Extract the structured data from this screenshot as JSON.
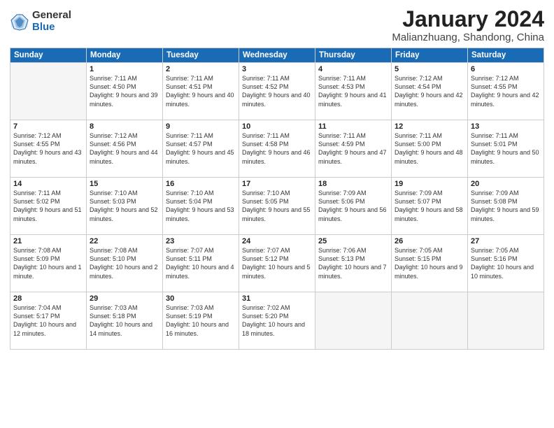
{
  "logo": {
    "general": "General",
    "blue": "Blue"
  },
  "title": "January 2024",
  "subtitle": "Malianzhuang, Shandong, China",
  "headers": [
    "Sunday",
    "Monday",
    "Tuesday",
    "Wednesday",
    "Thursday",
    "Friday",
    "Saturday"
  ],
  "weeks": [
    [
      {
        "day": "",
        "empty": true
      },
      {
        "day": "1",
        "sunrise": "Sunrise: 7:11 AM",
        "sunset": "Sunset: 4:50 PM",
        "daylight": "Daylight: 9 hours and 39 minutes."
      },
      {
        "day": "2",
        "sunrise": "Sunrise: 7:11 AM",
        "sunset": "Sunset: 4:51 PM",
        "daylight": "Daylight: 9 hours and 40 minutes."
      },
      {
        "day": "3",
        "sunrise": "Sunrise: 7:11 AM",
        "sunset": "Sunset: 4:52 PM",
        "daylight": "Daylight: 9 hours and 40 minutes."
      },
      {
        "day": "4",
        "sunrise": "Sunrise: 7:11 AM",
        "sunset": "Sunset: 4:53 PM",
        "daylight": "Daylight: 9 hours and 41 minutes."
      },
      {
        "day": "5",
        "sunrise": "Sunrise: 7:12 AM",
        "sunset": "Sunset: 4:54 PM",
        "daylight": "Daylight: 9 hours and 42 minutes."
      },
      {
        "day": "6",
        "sunrise": "Sunrise: 7:12 AM",
        "sunset": "Sunset: 4:55 PM",
        "daylight": "Daylight: 9 hours and 42 minutes."
      }
    ],
    [
      {
        "day": "7",
        "sunrise": "Sunrise: 7:12 AM",
        "sunset": "Sunset: 4:55 PM",
        "daylight": "Daylight: 9 hours and 43 minutes."
      },
      {
        "day": "8",
        "sunrise": "Sunrise: 7:12 AM",
        "sunset": "Sunset: 4:56 PM",
        "daylight": "Daylight: 9 hours and 44 minutes."
      },
      {
        "day": "9",
        "sunrise": "Sunrise: 7:11 AM",
        "sunset": "Sunset: 4:57 PM",
        "daylight": "Daylight: 9 hours and 45 minutes."
      },
      {
        "day": "10",
        "sunrise": "Sunrise: 7:11 AM",
        "sunset": "Sunset: 4:58 PM",
        "daylight": "Daylight: 9 hours and 46 minutes."
      },
      {
        "day": "11",
        "sunrise": "Sunrise: 7:11 AM",
        "sunset": "Sunset: 4:59 PM",
        "daylight": "Daylight: 9 hours and 47 minutes."
      },
      {
        "day": "12",
        "sunrise": "Sunrise: 7:11 AM",
        "sunset": "Sunset: 5:00 PM",
        "daylight": "Daylight: 9 hours and 48 minutes."
      },
      {
        "day": "13",
        "sunrise": "Sunrise: 7:11 AM",
        "sunset": "Sunset: 5:01 PM",
        "daylight": "Daylight: 9 hours and 50 minutes."
      }
    ],
    [
      {
        "day": "14",
        "sunrise": "Sunrise: 7:11 AM",
        "sunset": "Sunset: 5:02 PM",
        "daylight": "Daylight: 9 hours and 51 minutes."
      },
      {
        "day": "15",
        "sunrise": "Sunrise: 7:10 AM",
        "sunset": "Sunset: 5:03 PM",
        "daylight": "Daylight: 9 hours and 52 minutes."
      },
      {
        "day": "16",
        "sunrise": "Sunrise: 7:10 AM",
        "sunset": "Sunset: 5:04 PM",
        "daylight": "Daylight: 9 hours and 53 minutes."
      },
      {
        "day": "17",
        "sunrise": "Sunrise: 7:10 AM",
        "sunset": "Sunset: 5:05 PM",
        "daylight": "Daylight: 9 hours and 55 minutes."
      },
      {
        "day": "18",
        "sunrise": "Sunrise: 7:09 AM",
        "sunset": "Sunset: 5:06 PM",
        "daylight": "Daylight: 9 hours and 56 minutes."
      },
      {
        "day": "19",
        "sunrise": "Sunrise: 7:09 AM",
        "sunset": "Sunset: 5:07 PM",
        "daylight": "Daylight: 9 hours and 58 minutes."
      },
      {
        "day": "20",
        "sunrise": "Sunrise: 7:09 AM",
        "sunset": "Sunset: 5:08 PM",
        "daylight": "Daylight: 9 hours and 59 minutes."
      }
    ],
    [
      {
        "day": "21",
        "sunrise": "Sunrise: 7:08 AM",
        "sunset": "Sunset: 5:09 PM",
        "daylight": "Daylight: 10 hours and 1 minute."
      },
      {
        "day": "22",
        "sunrise": "Sunrise: 7:08 AM",
        "sunset": "Sunset: 5:10 PM",
        "daylight": "Daylight: 10 hours and 2 minutes."
      },
      {
        "day": "23",
        "sunrise": "Sunrise: 7:07 AM",
        "sunset": "Sunset: 5:11 PM",
        "daylight": "Daylight: 10 hours and 4 minutes."
      },
      {
        "day": "24",
        "sunrise": "Sunrise: 7:07 AM",
        "sunset": "Sunset: 5:12 PM",
        "daylight": "Daylight: 10 hours and 5 minutes."
      },
      {
        "day": "25",
        "sunrise": "Sunrise: 7:06 AM",
        "sunset": "Sunset: 5:13 PM",
        "daylight": "Daylight: 10 hours and 7 minutes."
      },
      {
        "day": "26",
        "sunrise": "Sunrise: 7:05 AM",
        "sunset": "Sunset: 5:15 PM",
        "daylight": "Daylight: 10 hours and 9 minutes."
      },
      {
        "day": "27",
        "sunrise": "Sunrise: 7:05 AM",
        "sunset": "Sunset: 5:16 PM",
        "daylight": "Daylight: 10 hours and 10 minutes."
      }
    ],
    [
      {
        "day": "28",
        "sunrise": "Sunrise: 7:04 AM",
        "sunset": "Sunset: 5:17 PM",
        "daylight": "Daylight: 10 hours and 12 minutes."
      },
      {
        "day": "29",
        "sunrise": "Sunrise: 7:03 AM",
        "sunset": "Sunset: 5:18 PM",
        "daylight": "Daylight: 10 hours and 14 minutes."
      },
      {
        "day": "30",
        "sunrise": "Sunrise: 7:03 AM",
        "sunset": "Sunset: 5:19 PM",
        "daylight": "Daylight: 10 hours and 16 minutes."
      },
      {
        "day": "31",
        "sunrise": "Sunrise: 7:02 AM",
        "sunset": "Sunset: 5:20 PM",
        "daylight": "Daylight: 10 hours and 18 minutes."
      },
      {
        "day": "",
        "empty": true
      },
      {
        "day": "",
        "empty": true
      },
      {
        "day": "",
        "empty": true
      }
    ]
  ]
}
